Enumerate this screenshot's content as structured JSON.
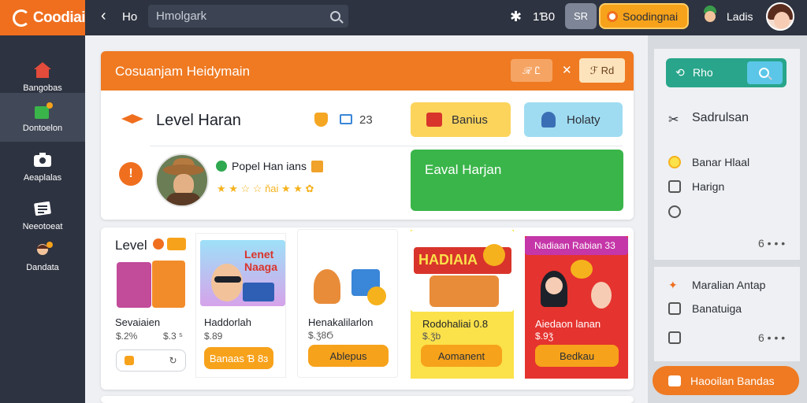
{
  "app": {
    "logo_text": "Coodiai"
  },
  "topbar": {
    "back_label": "Ho",
    "search_placeholder": "Hmolgark",
    "coins": "1Ɓ0",
    "sr_label": "SR",
    "cta_label": "Soodingnai",
    "user_name": "Ladis"
  },
  "sidebar": {
    "items": [
      {
        "label": "Bangobas",
        "icon": "home-icon"
      },
      {
        "label": "Dontoelon",
        "icon": "puzzle-icon"
      },
      {
        "label": "Aeaplalas",
        "icon": "camera-icon"
      },
      {
        "label": "Neeotoeat",
        "icon": "gamepad-icon"
      },
      {
        "label": "Dandata",
        "icon": "user-icon"
      }
    ]
  },
  "banner": {
    "title": "Cosuanjam Heidymain",
    "btn1": "ℛ Ꮭ",
    "close": "✕",
    "btn2": "ℱ Rd"
  },
  "level": {
    "title": "Level Haran",
    "count": "23",
    "bonus_button": "Banius",
    "holiday_button": "Holaty"
  },
  "player": {
    "alert": "!",
    "name": "Popel Han ians",
    "rating_text": "★ ★ ☆ ☆ ňai ★ ★ ✿",
    "green_banner": "Eaval Harjan"
  },
  "games_section": {
    "title": "Level",
    "cards": [
      {
        "label": "Sevaiaien",
        "price_left": "$.2%",
        "price_right": "$.3 ⁵",
        "button": ""
      },
      {
        "label": "Haddorlah",
        "price": "$.89",
        "button": "Banaas Ɓ 8ɜ"
      },
      {
        "label": "Henakalilarlon",
        "price": "$.ǯ8Ϭ",
        "button": "Ablepus"
      },
      {
        "label": "Rodohaliai 0.8",
        "price": "$.ǯb",
        "button": "Aomanent",
        "banner": "HADIAIA"
      },
      {
        "label": "Aiedaon lanan",
        "price": "$.9ǯ",
        "button": "Bedkau",
        "header": "Nadiaan Rabian 33"
      }
    ],
    "thumb2_text": "Lenet Naaga"
  },
  "right_panel": {
    "search_label": "Rho",
    "rows": [
      {
        "label": "Sadrulsan",
        "icon": "tools-icon"
      },
      {
        "label": "Banar Hlaal",
        "icon": "coin-icon"
      },
      {
        "label": "Harign",
        "icon": "chart-icon"
      },
      {
        "label": "",
        "icon": "key-icon"
      }
    ],
    "more1": "6 • • •",
    "row_group2": [
      {
        "label": "Maralian Antap",
        "icon": "party-icon"
      },
      {
        "label": "Banatuiga",
        "icon": "folder-icon"
      },
      {
        "label": "",
        "icon": "clock-icon"
      }
    ],
    "more2": "6 • • •",
    "cta": "Haooilan Bandas"
  },
  "colors": {
    "accent": "#ef6f1f",
    "dark": "#2d3340",
    "green": "#3ab54a",
    "teal": "#28a58a",
    "yellow": "#fcd45c",
    "cyan": "#9fdcf2"
  }
}
